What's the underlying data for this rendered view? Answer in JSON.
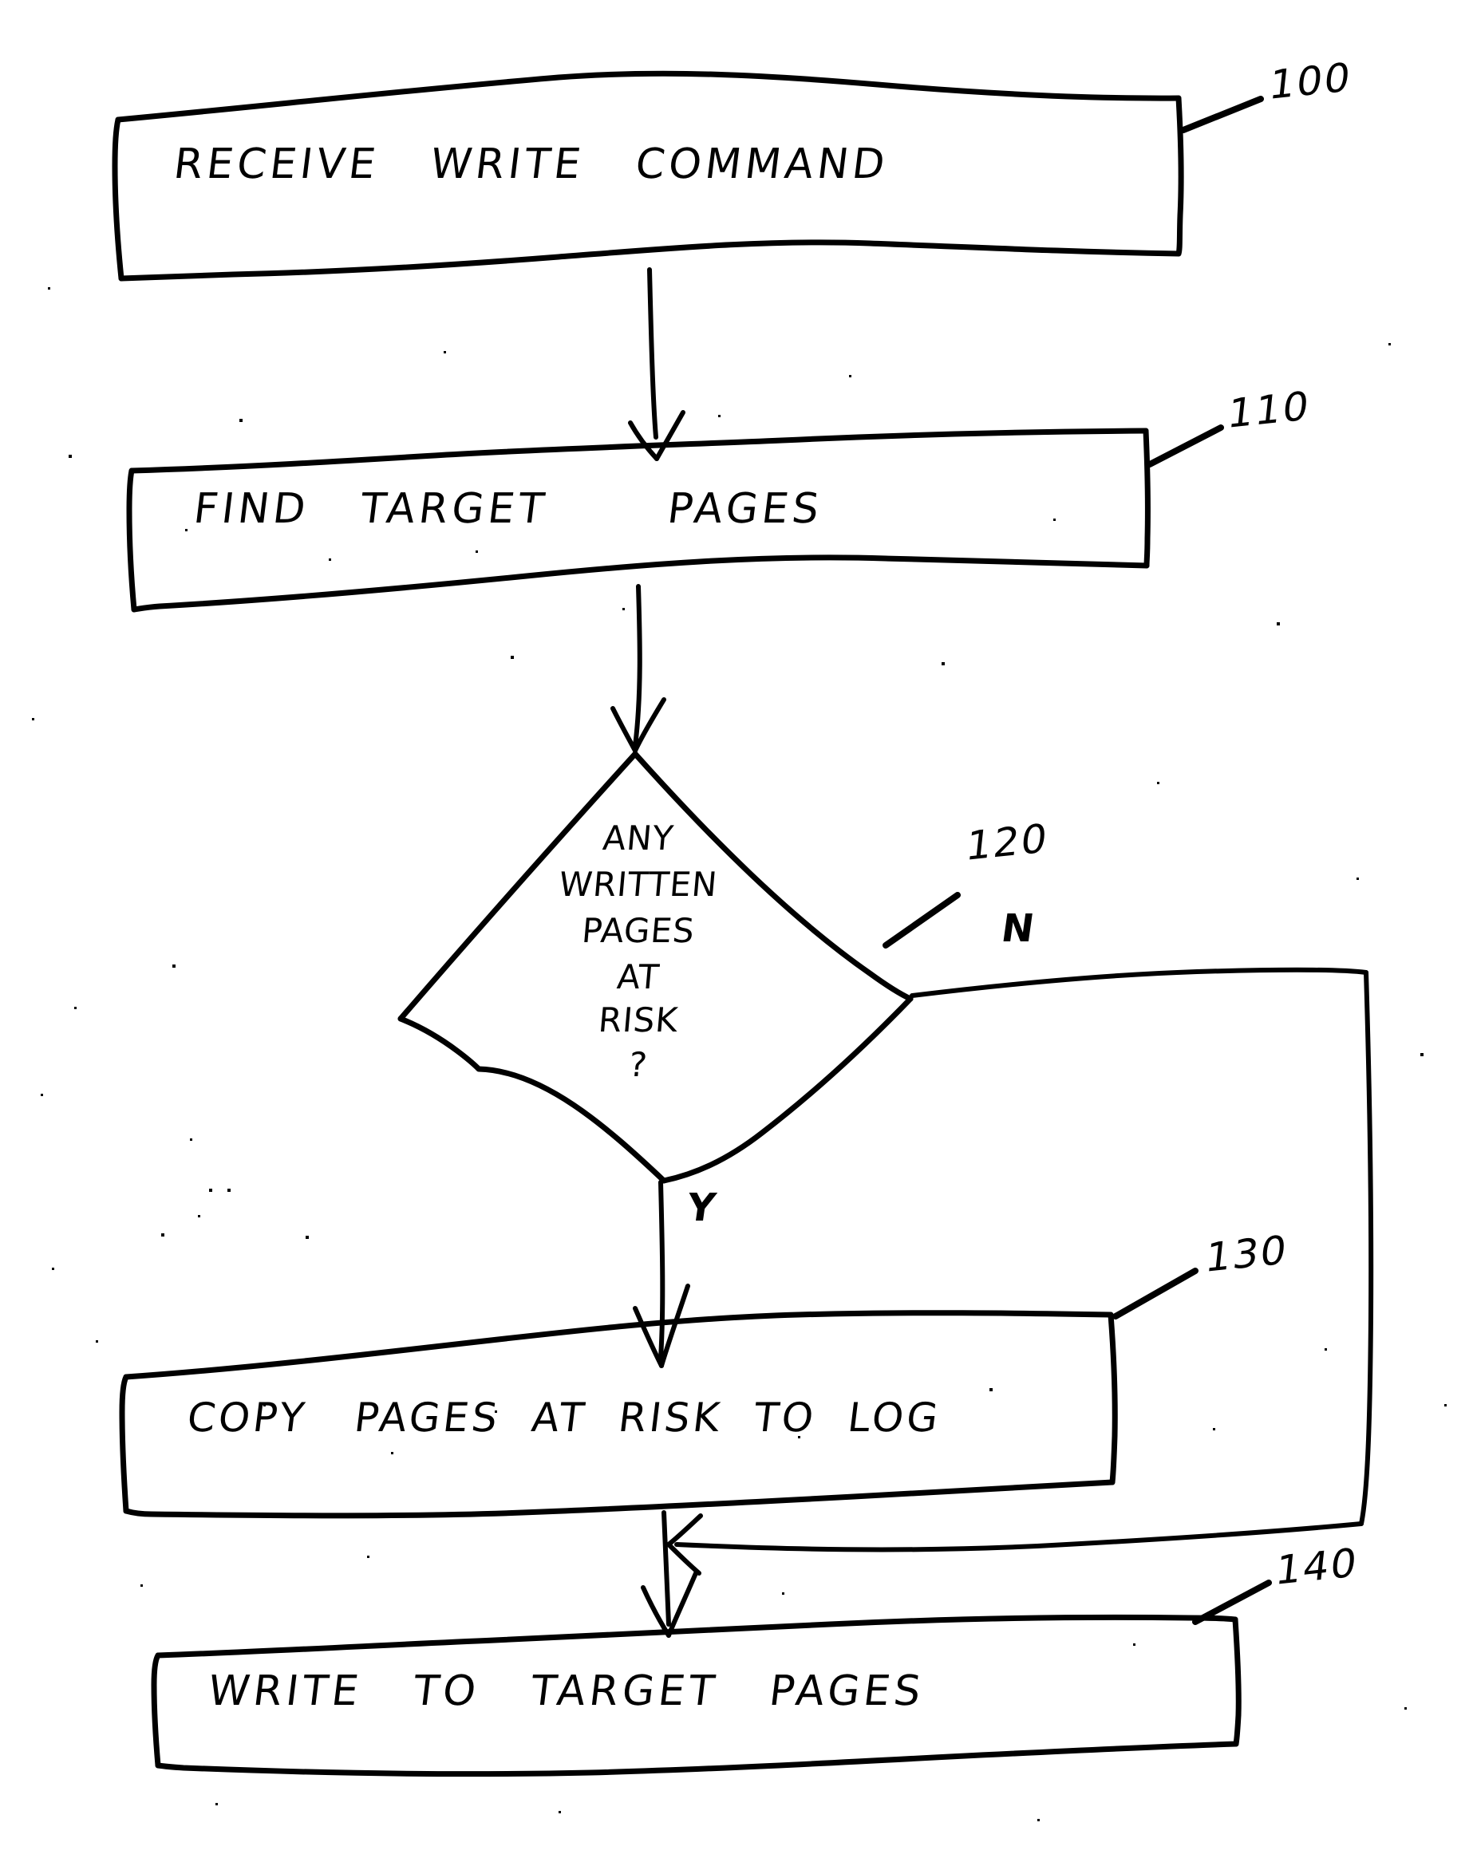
{
  "document": {
    "type": "hand-drawn patent flowchart",
    "title": "Write command handling flowchart"
  },
  "nodes": [
    {
      "id": "receive-write-command",
      "shape": "process",
      "label": "RECEIVE   WRITE   COMMAND",
      "ref": "100"
    },
    {
      "id": "find-target-pages",
      "shape": "process",
      "label": "FIND   TARGET       PAGES",
      "ref": "110"
    },
    {
      "id": "any-written-pages-at-risk",
      "shape": "decision",
      "label_lines": [
        "ANY",
        "WRITTEN",
        "PAGES",
        "AT",
        "RISK",
        "?"
      ],
      "ref": "120"
    },
    {
      "id": "copy-pages-at-risk-to-log",
      "shape": "process",
      "label": "COPY   PAGES  AT  RISK  TO  LOG",
      "ref": "130"
    },
    {
      "id": "write-to-target-pages",
      "shape": "process",
      "label": "WRITE   TO   TARGET   PAGES",
      "ref": "140"
    }
  ],
  "edges": [
    {
      "id": "e1",
      "from": "receive-write-command",
      "to": "find-target-pages",
      "label": ""
    },
    {
      "id": "e2",
      "from": "find-target-pages",
      "to": "any-written-pages-at-risk",
      "label": ""
    },
    {
      "id": "e3",
      "from": "any-written-pages-at-risk",
      "to": "copy-pages-at-risk-to-log",
      "label": "Y"
    },
    {
      "id": "e4",
      "from": "any-written-pages-at-risk",
      "to": "write-to-target-pages",
      "label": "N"
    },
    {
      "id": "e5",
      "from": "copy-pages-at-risk-to-log",
      "to": "write-to-target-pages",
      "label": ""
    }
  ],
  "branch_labels": {
    "yes": "Y",
    "no": "N"
  },
  "colors": {
    "ink": "#000000",
    "paper": "#ffffff"
  }
}
